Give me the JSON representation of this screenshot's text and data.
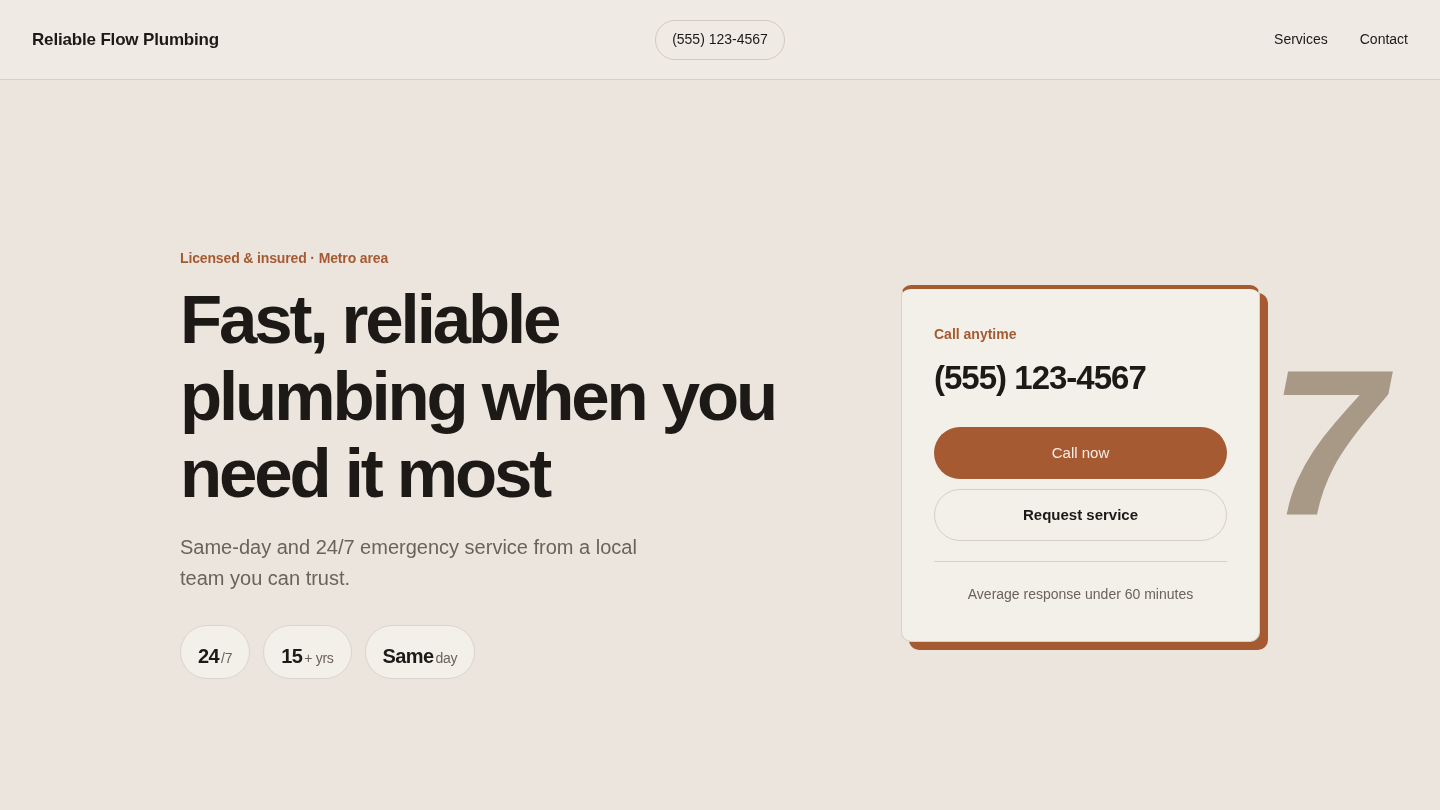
{
  "header": {
    "brand": "Reliable Flow Plumbing",
    "phone": "(555) 123-4567",
    "nav": [
      {
        "label": "Services"
      },
      {
        "label": "Contact"
      }
    ]
  },
  "hero": {
    "eyebrow": "Licensed & insured · Metro area",
    "headline": "Fast, reliable plumbing when you need it most",
    "subtext": "Same-day and 24/7 emergency service from a local team you can trust.",
    "stats": [
      {
        "value": "24",
        "suffix": "/7"
      },
      {
        "value": "15",
        "suffix": "+ yrs"
      },
      {
        "value": "Same",
        "suffix": "day"
      }
    ]
  },
  "backdrop_numeral": "7",
  "call_card": {
    "label": "Call anytime",
    "phone": "(555) 123-4567",
    "buttons": [
      {
        "label": "Call now",
        "kind": "primary"
      },
      {
        "label": "Request service",
        "kind": "secondary"
      }
    ],
    "note": "Average response under 60 minutes"
  }
}
